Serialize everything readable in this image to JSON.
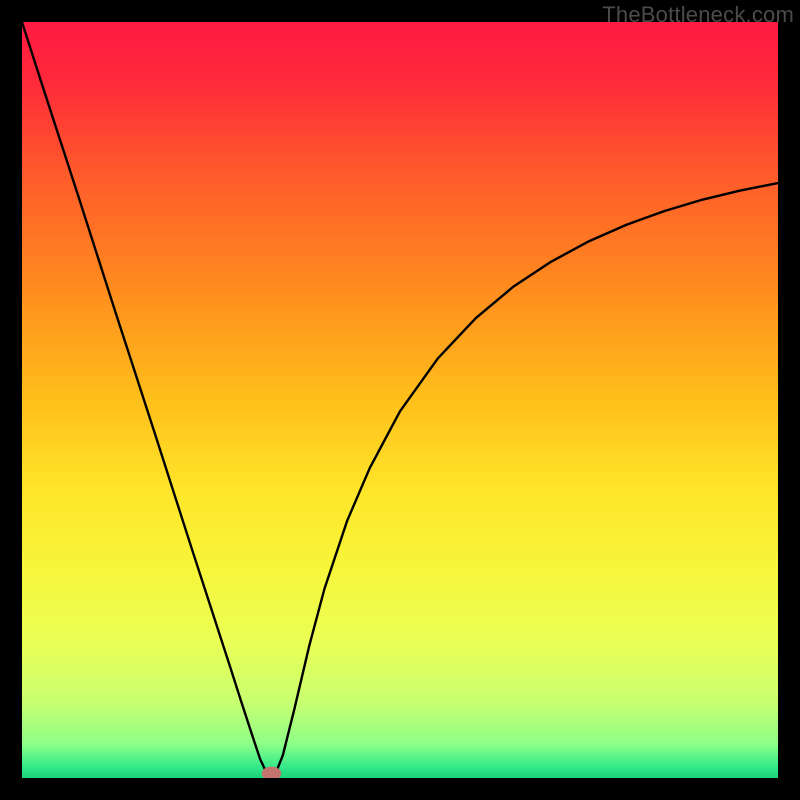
{
  "watermark": {
    "text": "TheBottleneck.com"
  },
  "chart_data": {
    "type": "line",
    "title": "",
    "xlabel": "",
    "ylabel": "",
    "xlim": [
      0,
      100
    ],
    "ylim": [
      0,
      100
    ],
    "grid": false,
    "legend": false,
    "background": {
      "stops": [
        {
          "offset": 0.0,
          "color": "#ff1a43"
        },
        {
          "offset": 0.08,
          "color": "#ff2a3a"
        },
        {
          "offset": 0.2,
          "color": "#ff5a2b"
        },
        {
          "offset": 0.35,
          "color": "#ff8b1e"
        },
        {
          "offset": 0.5,
          "color": "#ffbf1a"
        },
        {
          "offset": 0.62,
          "color": "#ffe62a"
        },
        {
          "offset": 0.72,
          "color": "#f7f53a"
        },
        {
          "offset": 0.82,
          "color": "#eaff55"
        },
        {
          "offset": 0.9,
          "color": "#c8ff70"
        },
        {
          "offset": 0.955,
          "color": "#8dff88"
        },
        {
          "offset": 0.985,
          "color": "#35e989"
        },
        {
          "offset": 1.0,
          "color": "#17d477"
        }
      ]
    },
    "series": [
      {
        "name": "bottleneck-curve",
        "color": "#000000",
        "width": 2.4,
        "x": [
          0.0,
          2.5,
          5.0,
          7.5,
          10.0,
          12.5,
          15.0,
          17.5,
          20.0,
          22.5,
          25.0,
          27.5,
          29.0,
          30.5,
          31.5,
          32.3,
          33.0,
          33.7,
          34.5,
          36.0,
          38.0,
          40.0,
          43.0,
          46.0,
          50.0,
          55.0,
          60.0,
          65.0,
          70.0,
          75.0,
          80.0,
          85.0,
          90.0,
          95.0,
          100.0
        ],
        "y": [
          100.0,
          92.2,
          84.5,
          76.8,
          69.0,
          61.2,
          53.5,
          45.8,
          38.0,
          30.2,
          22.5,
          14.8,
          10.1,
          5.5,
          2.5,
          0.8,
          0.2,
          1.0,
          3.0,
          9.0,
          17.5,
          25.0,
          34.0,
          41.0,
          48.5,
          55.5,
          60.8,
          65.0,
          68.3,
          71.0,
          73.2,
          75.0,
          76.5,
          77.7,
          78.7
        ]
      }
    ],
    "marker": {
      "name": "optimal-point",
      "x": 33.0,
      "y": 0.6,
      "rx": 1.3,
      "ry": 0.9,
      "fill": "#c5736d"
    }
  }
}
